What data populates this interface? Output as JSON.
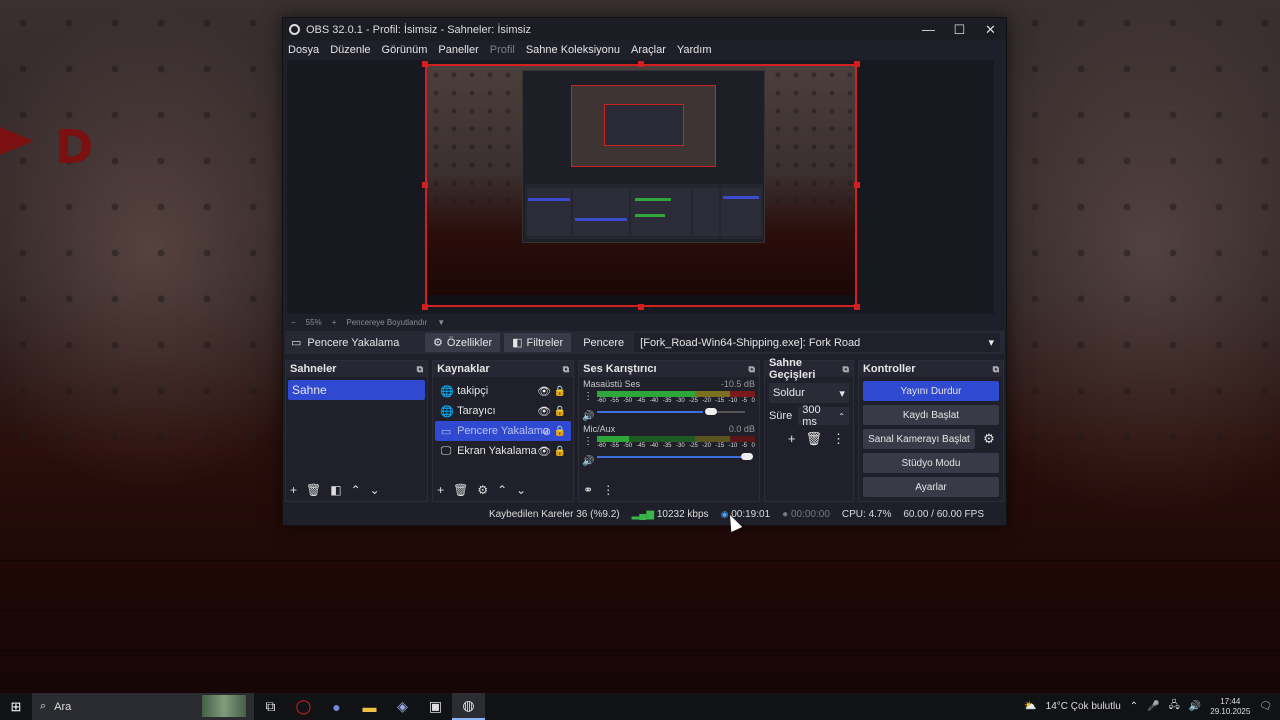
{
  "window": {
    "title": "OBS 32.0.1 - Profil: İsimsiz - Sahneler: İsimsiz",
    "minimize": "—",
    "maximize": "☐",
    "close": "✕"
  },
  "menu": [
    "Dosya",
    "Düzenle",
    "Görünüm",
    "Paneller",
    "Profil",
    "Sahne Koleksiyonu",
    "Araçlar",
    "Yardım"
  ],
  "zoom": {
    "minus": "−",
    "value": "55%",
    "plus": "+",
    "fit": "Pencereye Boyutlandır"
  },
  "context_bar": {
    "source_name": "Pencere Yakalama",
    "properties": "Özellikler",
    "filters": "Filtreler",
    "window_label": "Pencere",
    "window_value": "[Fork_Road-Win64-Shipping.exe]: Fork Road"
  },
  "scenes": {
    "title": "Sahneler",
    "items": [
      "Sahne"
    ]
  },
  "sources": {
    "title": "Kaynaklar",
    "items": [
      {
        "name": "takipçi",
        "icon": "globe-icon"
      },
      {
        "name": "Tarayıcı",
        "icon": "globe-icon"
      },
      {
        "name": "Pencere Yakalama",
        "icon": "window-icon"
      },
      {
        "name": "Ekran Yakalama",
        "icon": "monitor-icon"
      }
    ]
  },
  "mixer": {
    "title": "Ses Karıştırıcı",
    "channels": [
      {
        "name": "Masaüstü Ses",
        "db": "-10.5 dB",
        "level": 0.55,
        "volume": 0.73
      },
      {
        "name": "Mic/Aux",
        "db": "0.0 dB",
        "level": 0.2,
        "volume": 1.0
      }
    ],
    "ticks": [
      "-60",
      "-55",
      "-50",
      "-45",
      "-40",
      "-35",
      "-30",
      "-25",
      "-20",
      "-15",
      "-10",
      "-5",
      "0"
    ]
  },
  "transitions": {
    "title": "Sahne Geçişleri",
    "selected": "Soldur",
    "duration_label": "Süre",
    "duration_value": "300 ms"
  },
  "controls": {
    "title": "Kontroller",
    "stop_stream": "Yayını Durdur",
    "start_record": "Kaydı Başlat",
    "virtual_cam": "Sanal Kamerayı Başlat",
    "studio_mode": "Stüdyo Modu",
    "settings": "Ayarlar"
  },
  "status": {
    "dropped": "Kaybedilen Kareler 36 (%9.2)",
    "bitrate": "10232 kbps",
    "stream_time": "00:19:01",
    "record_time": "00:00:00",
    "cpu": "CPU: 4.7%",
    "fps": "60.00 / 60.00 FPS"
  },
  "taskbar": {
    "search": "Ara",
    "weather": "14°C  Çok bulutlu",
    "time": "17:44",
    "date": "29.10.2025"
  },
  "colors": {
    "accent": "#2f49d1",
    "selection": "#d21f1f",
    "meter_green": "#2fa63a",
    "meter_yellow": "#b09020",
    "meter_red": "#b02020"
  }
}
